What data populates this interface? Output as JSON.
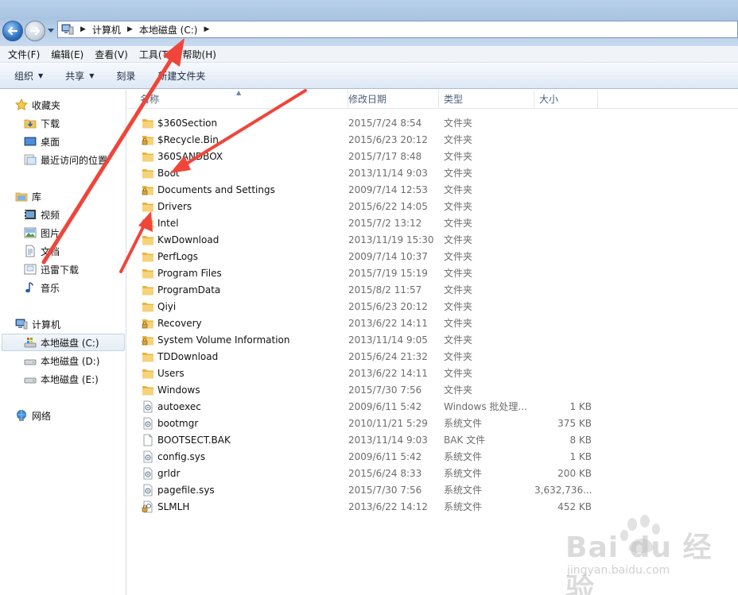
{
  "address": {
    "crumbs": [
      "计算机",
      "本地磁盘 (C:)"
    ]
  },
  "menu": [
    "文件(F)",
    "编辑(E)",
    "查看(V)",
    "工具(T)",
    "帮助(H)"
  ],
  "commands": [
    {
      "label": "组织",
      "dropdown": true
    },
    {
      "label": "共享",
      "dropdown": true
    },
    {
      "label": "刻录",
      "dropdown": false
    },
    {
      "label": "新建文件夹",
      "dropdown": false
    }
  ],
  "nav": {
    "favorites": {
      "label": "收藏夹",
      "items": [
        "下载",
        "桌面",
        "最近访问的位置"
      ]
    },
    "libraries": {
      "label": "库",
      "items": [
        "视频",
        "图片",
        "文档",
        "迅雷下载",
        "音乐"
      ]
    },
    "computer": {
      "label": "计算机",
      "items": [
        "本地磁盘 (C:)",
        "本地磁盘 (D:)",
        "本地磁盘 (E:)"
      ],
      "selected_index": 0
    },
    "network": {
      "label": "网络"
    }
  },
  "columns": {
    "name": "名称",
    "date": "修改日期",
    "type": "类型",
    "size": "大小"
  },
  "files": [
    {
      "name": "$360Section",
      "date": "2015/7/24 8:54",
      "type": "文件夹",
      "size": "",
      "icon": "folder-icon"
    },
    {
      "name": "$Recycle.Bin",
      "date": "2015/6/23 20:12",
      "type": "文件夹",
      "size": "",
      "icon": "locked-folder-icon"
    },
    {
      "name": "360SANDBOX",
      "date": "2015/7/17 8:48",
      "type": "文件夹",
      "size": "",
      "icon": "folder-icon"
    },
    {
      "name": "Boot",
      "date": "2013/11/14 9:03",
      "type": "文件夹",
      "size": "",
      "icon": "folder-icon"
    },
    {
      "name": "Documents and Settings",
      "date": "2009/7/14 12:53",
      "type": "文件夹",
      "size": "",
      "icon": "locked-folder-icon"
    },
    {
      "name": "Drivers",
      "date": "2015/6/22 14:05",
      "type": "文件夹",
      "size": "",
      "icon": "folder-icon"
    },
    {
      "name": "Intel",
      "date": "2015/7/2 13:12",
      "type": "文件夹",
      "size": "",
      "icon": "folder-icon"
    },
    {
      "name": "KwDownload",
      "date": "2013/11/19 15:30",
      "type": "文件夹",
      "size": "",
      "icon": "folder-icon"
    },
    {
      "name": "PerfLogs",
      "date": "2009/7/14 10:37",
      "type": "文件夹",
      "size": "",
      "icon": "folder-icon"
    },
    {
      "name": "Program Files",
      "date": "2015/7/19 15:19",
      "type": "文件夹",
      "size": "",
      "icon": "folder-icon"
    },
    {
      "name": "ProgramData",
      "date": "2015/8/2 11:57",
      "type": "文件夹",
      "size": "",
      "icon": "folder-icon"
    },
    {
      "name": "Qiyi",
      "date": "2015/6/23 20:12",
      "type": "文件夹",
      "size": "",
      "icon": "folder-icon"
    },
    {
      "name": "Recovery",
      "date": "2013/6/22 14:11",
      "type": "文件夹",
      "size": "",
      "icon": "locked-folder-icon"
    },
    {
      "name": "System Volume Information",
      "date": "2013/11/14 9:05",
      "type": "文件夹",
      "size": "",
      "icon": "locked-folder-icon"
    },
    {
      "name": "TDDownload",
      "date": "2015/6/24 21:32",
      "type": "文件夹",
      "size": "",
      "icon": "folder-icon"
    },
    {
      "name": "Users",
      "date": "2013/6/22 14:11",
      "type": "文件夹",
      "size": "",
      "icon": "folder-icon"
    },
    {
      "name": "Windows",
      "date": "2015/7/30 7:56",
      "type": "文件夹",
      "size": "",
      "icon": "folder-icon"
    },
    {
      "name": "autoexec",
      "date": "2009/6/11 5:42",
      "type": "Windows 批处理...",
      "size": "1 KB",
      "icon": "batch-file-icon"
    },
    {
      "name": "bootmgr",
      "date": "2010/11/21 5:29",
      "type": "系统文件",
      "size": "375 KB",
      "icon": "system-file-icon"
    },
    {
      "name": "BOOTSECT.BAK",
      "date": "2013/11/14 9:03",
      "type": "BAK 文件",
      "size": "8 KB",
      "icon": "blank-file-icon"
    },
    {
      "name": "config.sys",
      "date": "2009/6/11 5:42",
      "type": "系统文件",
      "size": "1 KB",
      "icon": "system-file-icon"
    },
    {
      "name": "grldr",
      "date": "2015/6/24 8:33",
      "type": "系统文件",
      "size": "200 KB",
      "icon": "system-file-icon"
    },
    {
      "name": "pagefile.sys",
      "date": "2015/7/30 7:56",
      "type": "系统文件",
      "size": "3,632,736...",
      "icon": "system-file-icon"
    },
    {
      "name": "SLMLH",
      "date": "2013/6/22 14:12",
      "type": "系统文件",
      "size": "452 KB",
      "icon": "locked-system-file-icon"
    }
  ],
  "watermark": {
    "text": "Bai du 经验",
    "sub": "jingyan.baidu.com"
  },
  "colors": {
    "arrow": "#f0453a",
    "folder": "#f2c65c",
    "selection": "#e5edf6"
  }
}
